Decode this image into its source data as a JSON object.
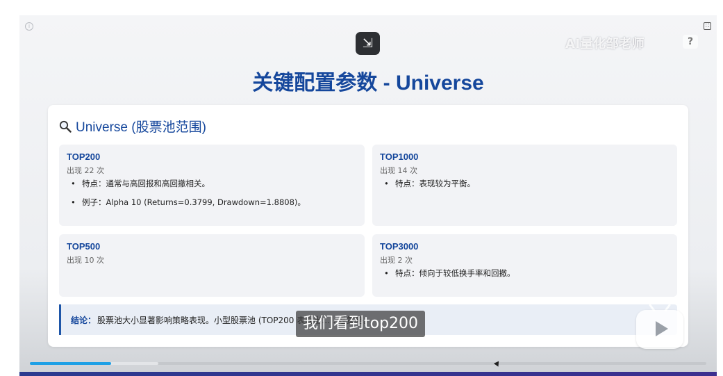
{
  "slide": {
    "title": "关键配置参数 - Universe",
    "section_heading": "Universe (股票池范围)",
    "cards": [
      {
        "title": "TOP200",
        "count": "出现 22 次",
        "bullets": [
          "特点：通常与高回报和高回撤相关。",
          "例子：Alpha 10 (Returns=0.3799, Drawdown=1.8808)。"
        ]
      },
      {
        "title": "TOP1000",
        "count": "出现 14 次",
        "bullets": [
          "特点：表现较为平衡。"
        ]
      },
      {
        "title": "TOP500",
        "count": "出现 10 次",
        "bullets": []
      },
      {
        "title": "TOP3000",
        "count": "出现 2 次",
        "bullets": [
          "特点：倾向于较低换手率和回撤。"
        ]
      }
    ],
    "conclusion_label": "结论：",
    "conclusion_text": "股票池大小显著影响策略表现。小型股票池 (TOP200 表现出……性策略。"
  },
  "player": {
    "watermark": "AI量化邹老师",
    "subtitle": "我们看到top200",
    "progress": 0.12,
    "buffered": 0.19,
    "colors": {
      "accent": "#1ea0e6",
      "title": "#15479c"
    },
    "icons": [
      "info-icon",
      "expand-icon",
      "pip-icon",
      "play-icon",
      "magnifier-icon"
    ]
  }
}
